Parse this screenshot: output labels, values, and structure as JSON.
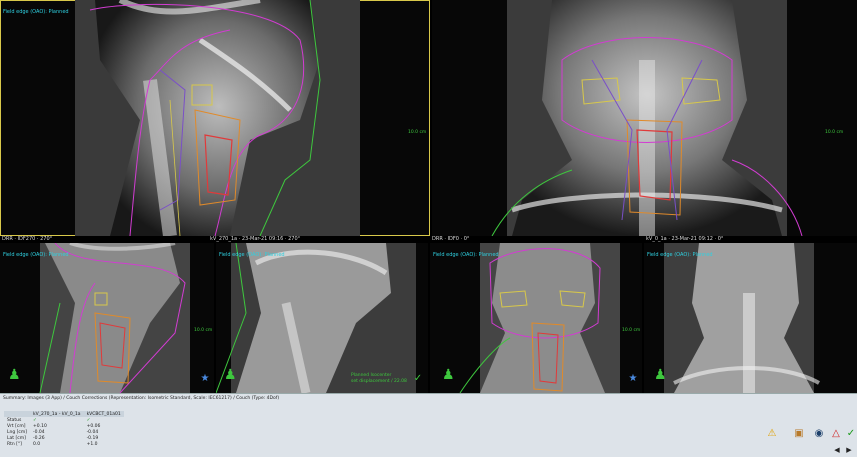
{
  "views": {
    "top_left": {
      "label": "Field edge (OAO): Planned",
      "scale": "10.0 cm"
    },
    "top_right": {
      "scale": "10.0 cm"
    },
    "bottom_1": {
      "header": "DRR · IDF270 · 270°",
      "label": "Field edge (OAO): Planned",
      "scale": "10.0 cm"
    },
    "bottom_2": {
      "header": "kV_270_1a · 23-Mar-21 09:16 · 270°",
      "label": "Field edge (OAO): Planned",
      "ghost_text": [
        "Planned Isocenter",
        "set displacement / 22.08"
      ]
    },
    "bottom_3": {
      "header": "DRR · IDF0 · 0°",
      "label": "Field edge (OAO): Planned",
      "scale": "10.0 cm"
    },
    "bottom_4": {
      "header": "kV_0_1a · 23-Mar-21 09:12 · 0°",
      "label": "Field edge (OAO): Planned"
    }
  },
  "summary": {
    "title": "Summary: Images (3 App) / Couch Corrections (Representation: Isometric Standard, Scale: IEC61217) / Couch (Type: 4Dof)",
    "columns": [
      "",
      "kV_270_1a - kV_0_1a",
      "kVCBCT_01a01"
    ],
    "rows": [
      [
        "Status",
        "✓",
        "✓"
      ],
      [
        "Vrt [cm]",
        "+0.10",
        "+0.06"
      ],
      [
        "Lng [cm]",
        "-0.04",
        "-0.04"
      ],
      [
        "Lat [cm]",
        "-0.26",
        "-0.19"
      ],
      [
        "Rtn [°]",
        "0.0",
        "+1.0"
      ]
    ]
  },
  "icons": [
    "warning-icon",
    "clipboard-icon",
    "eye-icon",
    "alert-triangle-icon",
    "checkmark-icon"
  ],
  "colors": {
    "contour_magenta": "#d23cd2",
    "contour_yellow": "#d8c84a",
    "contour_orange": "#e08a2a",
    "contour_red": "#e03a3a",
    "contour_purple": "#7a4fc8",
    "field_green": "#3ec73e",
    "label_cyan": "#2fd0e0"
  }
}
